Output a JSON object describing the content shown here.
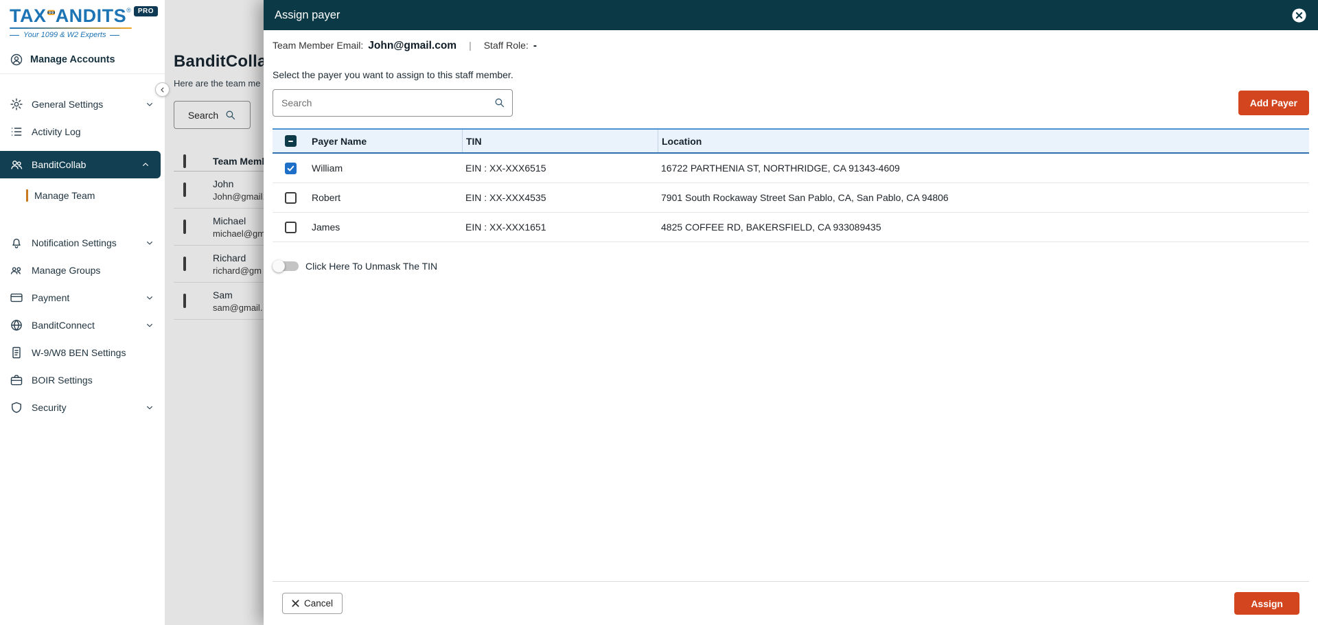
{
  "brand": {
    "tax": "TAX",
    "andits": "ANDITS",
    "registered": "®",
    "pro": "PRO",
    "tagline": "Your 1099 & W2 Experts"
  },
  "sidebar": {
    "manage_accounts": "Manage Accounts",
    "items": [
      {
        "label": "General Settings"
      },
      {
        "label": "Activity Log"
      },
      {
        "label": "BanditCollab"
      },
      {
        "label": "Notification Settings"
      },
      {
        "label": "Manage Groups"
      },
      {
        "label": "Payment"
      },
      {
        "label": "BanditConnect"
      },
      {
        "label": "W-9/W8 BEN Settings"
      },
      {
        "label": "BOIR Settings"
      },
      {
        "label": "Security"
      }
    ],
    "manage_team": "Manage Team"
  },
  "main": {
    "title": "BanditCollab (",
    "subtitle": "Here are the team me",
    "search_label": "Search",
    "table": {
      "header": "Team Memb",
      "rows": [
        {
          "name": "John",
          "email": "John@gmail."
        },
        {
          "name": "Michael",
          "email": "michael@gm"
        },
        {
          "name": "Richard",
          "email": "richard@gm"
        },
        {
          "name": "Sam",
          "email": "sam@gmail."
        }
      ]
    }
  },
  "modal": {
    "title": "Assign payer",
    "team_member_email_label": "Team Member Email:",
    "team_member_email": "John@gmail.com",
    "separator": "|",
    "staff_role_label": "Staff Role:",
    "staff_role_value": "-",
    "instruction": "Select the payer you want to assign to this staff member.",
    "search_placeholder": "Search",
    "add_payer_label": "Add Payer",
    "table": {
      "columns": [
        "Payer Name",
        "TIN",
        "Location"
      ],
      "rows": [
        {
          "name": "William",
          "tin": "EIN : XX-XXX6515",
          "location": "16722 PARTHENIA ST, NORTHRIDGE, CA 91343-4609",
          "checked": true
        },
        {
          "name": "Robert",
          "tin": "EIN : XX-XXX4535",
          "location": "7901 South Rockaway Street San Pablo, CA, San Pablo, CA 94806",
          "checked": false
        },
        {
          "name": "James",
          "tin": "EIN : XX-XXX1651",
          "location": "4825 COFFEE RD, BAKERSFIELD, CA 933089435",
          "checked": false
        }
      ]
    },
    "unmask_label": "Click Here To Unmask The TIN",
    "cancel_label": "Cancel",
    "assign_label": "Assign"
  },
  "colors": {
    "header_dark": "#0b3a46",
    "accent_orange": "#d2451f",
    "checkbox_blue": "#1e6fc8",
    "table_header_bg": "#eaf2fb",
    "brand_blue": "#1d74b5"
  }
}
